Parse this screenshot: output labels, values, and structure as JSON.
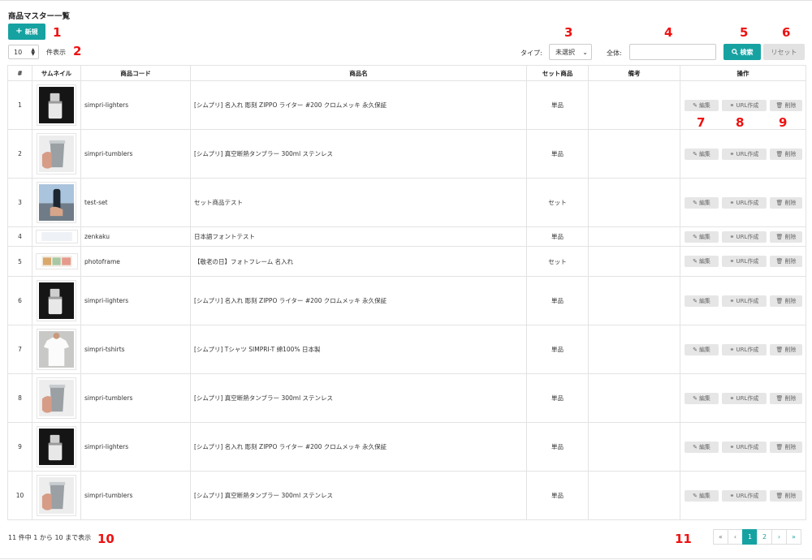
{
  "page": {
    "title": "商品マスター一覧"
  },
  "toolbar": {
    "new_label": "新規",
    "per_page_value": "10",
    "per_page_suffix": "件表示"
  },
  "filters": {
    "type_label": "タイプ:",
    "type_value": "未選択",
    "all_label": "全体:",
    "search_value": "",
    "search_button": "検索",
    "reset_button": "リセット"
  },
  "annotations": [
    "1",
    "2",
    "3",
    "4",
    "5",
    "6",
    "7",
    "8",
    "9",
    "10",
    "11"
  ],
  "table": {
    "headers": [
      "#",
      "サムネイル",
      "商品コード",
      "商品名",
      "セット商品",
      "備考",
      "操作"
    ],
    "actions": {
      "edit": "編集",
      "url": "URL作成",
      "delete": "削除"
    },
    "rows": [
      {
        "num": "1",
        "code": "simpri-lighters",
        "name": "[シムプリ] 名入れ 彫刻 ZIPPO ライター #200 クロムメッキ 永久保証",
        "set": "単品",
        "note": "",
        "thumb": "lighter"
      },
      {
        "num": "2",
        "code": "simpri-tumblers",
        "name": "[シムプリ] 真空断熱タンブラー 300ml ステンレス",
        "set": "単品",
        "note": "",
        "thumb": "tumbler"
      },
      {
        "num": "3",
        "code": "test-set",
        "name": "セット商品テスト",
        "set": "セット",
        "note": "",
        "thumb": "bottle"
      },
      {
        "num": "4",
        "code": "zenkaku",
        "name": "日本語フォントテスト",
        "set": "単品",
        "note": "",
        "thumb": "blank"
      },
      {
        "num": "5",
        "code": "photoframe",
        "name": "【敬老の日】フォトフレーム 名入れ",
        "set": "セット",
        "note": "",
        "thumb": "frame"
      },
      {
        "num": "6",
        "code": "simpri-lighters",
        "name": "[シムプリ] 名入れ 彫刻 ZIPPO ライター #200 クロムメッキ 永久保証",
        "set": "単品",
        "note": "",
        "thumb": "lighter"
      },
      {
        "num": "7",
        "code": "simpri-tshirts",
        "name": "[シムプリ] Tシャツ SIMPRI-T 綿100% 日本製",
        "set": "単品",
        "note": "",
        "thumb": "tshirt"
      },
      {
        "num": "8",
        "code": "simpri-tumblers",
        "name": "[シムプリ] 真空断熱タンブラー 300ml ステンレス",
        "set": "単品",
        "note": "",
        "thumb": "tumbler"
      },
      {
        "num": "9",
        "code": "simpri-lighters",
        "name": "[シムプリ] 名入れ 彫刻 ZIPPO ライター #200 クロムメッキ 永久保証",
        "set": "単品",
        "note": "",
        "thumb": "lighter"
      },
      {
        "num": "10",
        "code": "simpri-tumblers",
        "name": "[シムプリ] 真空断熱タンブラー 300ml ステンレス",
        "set": "単品",
        "note": "",
        "thumb": "tumbler"
      }
    ]
  },
  "footer": {
    "info": "11 件中 1 から 10 まで表示"
  },
  "pagination": {
    "first": "«",
    "prev": "‹",
    "pages": [
      "1",
      "2"
    ],
    "active": "1",
    "next": "›",
    "last": "»"
  },
  "colors": {
    "accent": "#17a2a2",
    "annotation": "#e11111",
    "button_gray": "#e6e6e6"
  }
}
